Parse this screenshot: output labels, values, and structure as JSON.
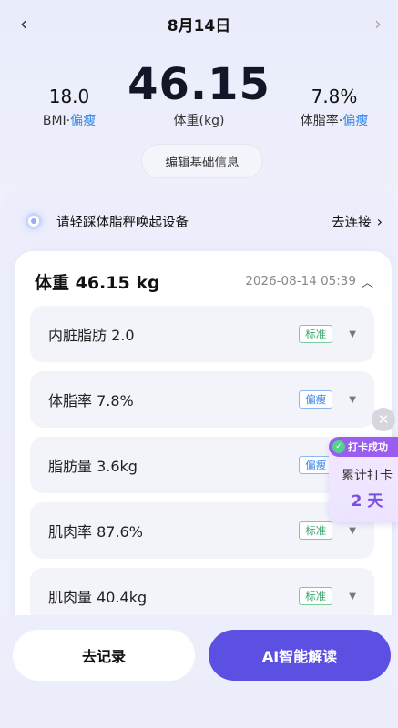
{
  "nav": {
    "prev_icon": "chevron-left-icon",
    "date": "8月14日",
    "next_icon": "chevron-right-icon"
  },
  "stats": {
    "bmi": {
      "value": "18.0",
      "label": "BMI",
      "sep": "·",
      "status": "偏瘦"
    },
    "weight": {
      "value": "46.15",
      "label": "体重(kg)"
    },
    "body_fat": {
      "value": "7.8%",
      "label": "体脂率",
      "sep": "·",
      "status": "偏瘦"
    }
  },
  "edit_button": "编辑基础信息",
  "device": {
    "prompt": "请轻踩体脂秤唤起设备",
    "connect": "去连接",
    "connect_icon": "chevron-right-icon"
  },
  "record": {
    "title": "体重 46.15 kg",
    "timestamp": "2026-08-14 05:39",
    "collapse_icon": "chevron-up-icon",
    "metrics": [
      {
        "name": "内脏脂肪 2.0",
        "badge": "标准",
        "badge_color": "#3ea772"
      },
      {
        "name": "体脂率 7.8%",
        "badge": "偏瘦",
        "badge_color": "#3a86e8"
      },
      {
        "name": "脂肪量 3.6kg",
        "badge": "偏瘦",
        "badge_color": "#3a86e8"
      },
      {
        "name": "肌肉率 87.6%",
        "badge": "标准",
        "badge_color": "#3ea772"
      },
      {
        "name": "肌肉量 40.4kg",
        "badge": "标准",
        "badge_color": "#3ea772"
      }
    ]
  },
  "checkin": {
    "tag": "打卡成功",
    "label": "累计打卡",
    "days": "2 天",
    "close_icon": "close-icon"
  },
  "actions": {
    "record": "去记录",
    "ai": "AI智能解读"
  },
  "colors": {
    "accent": "#5c50e2",
    "status_blue": "#3a86e8",
    "status_green": "#3ea772",
    "checkin_purple": "#9b5cf0"
  }
}
